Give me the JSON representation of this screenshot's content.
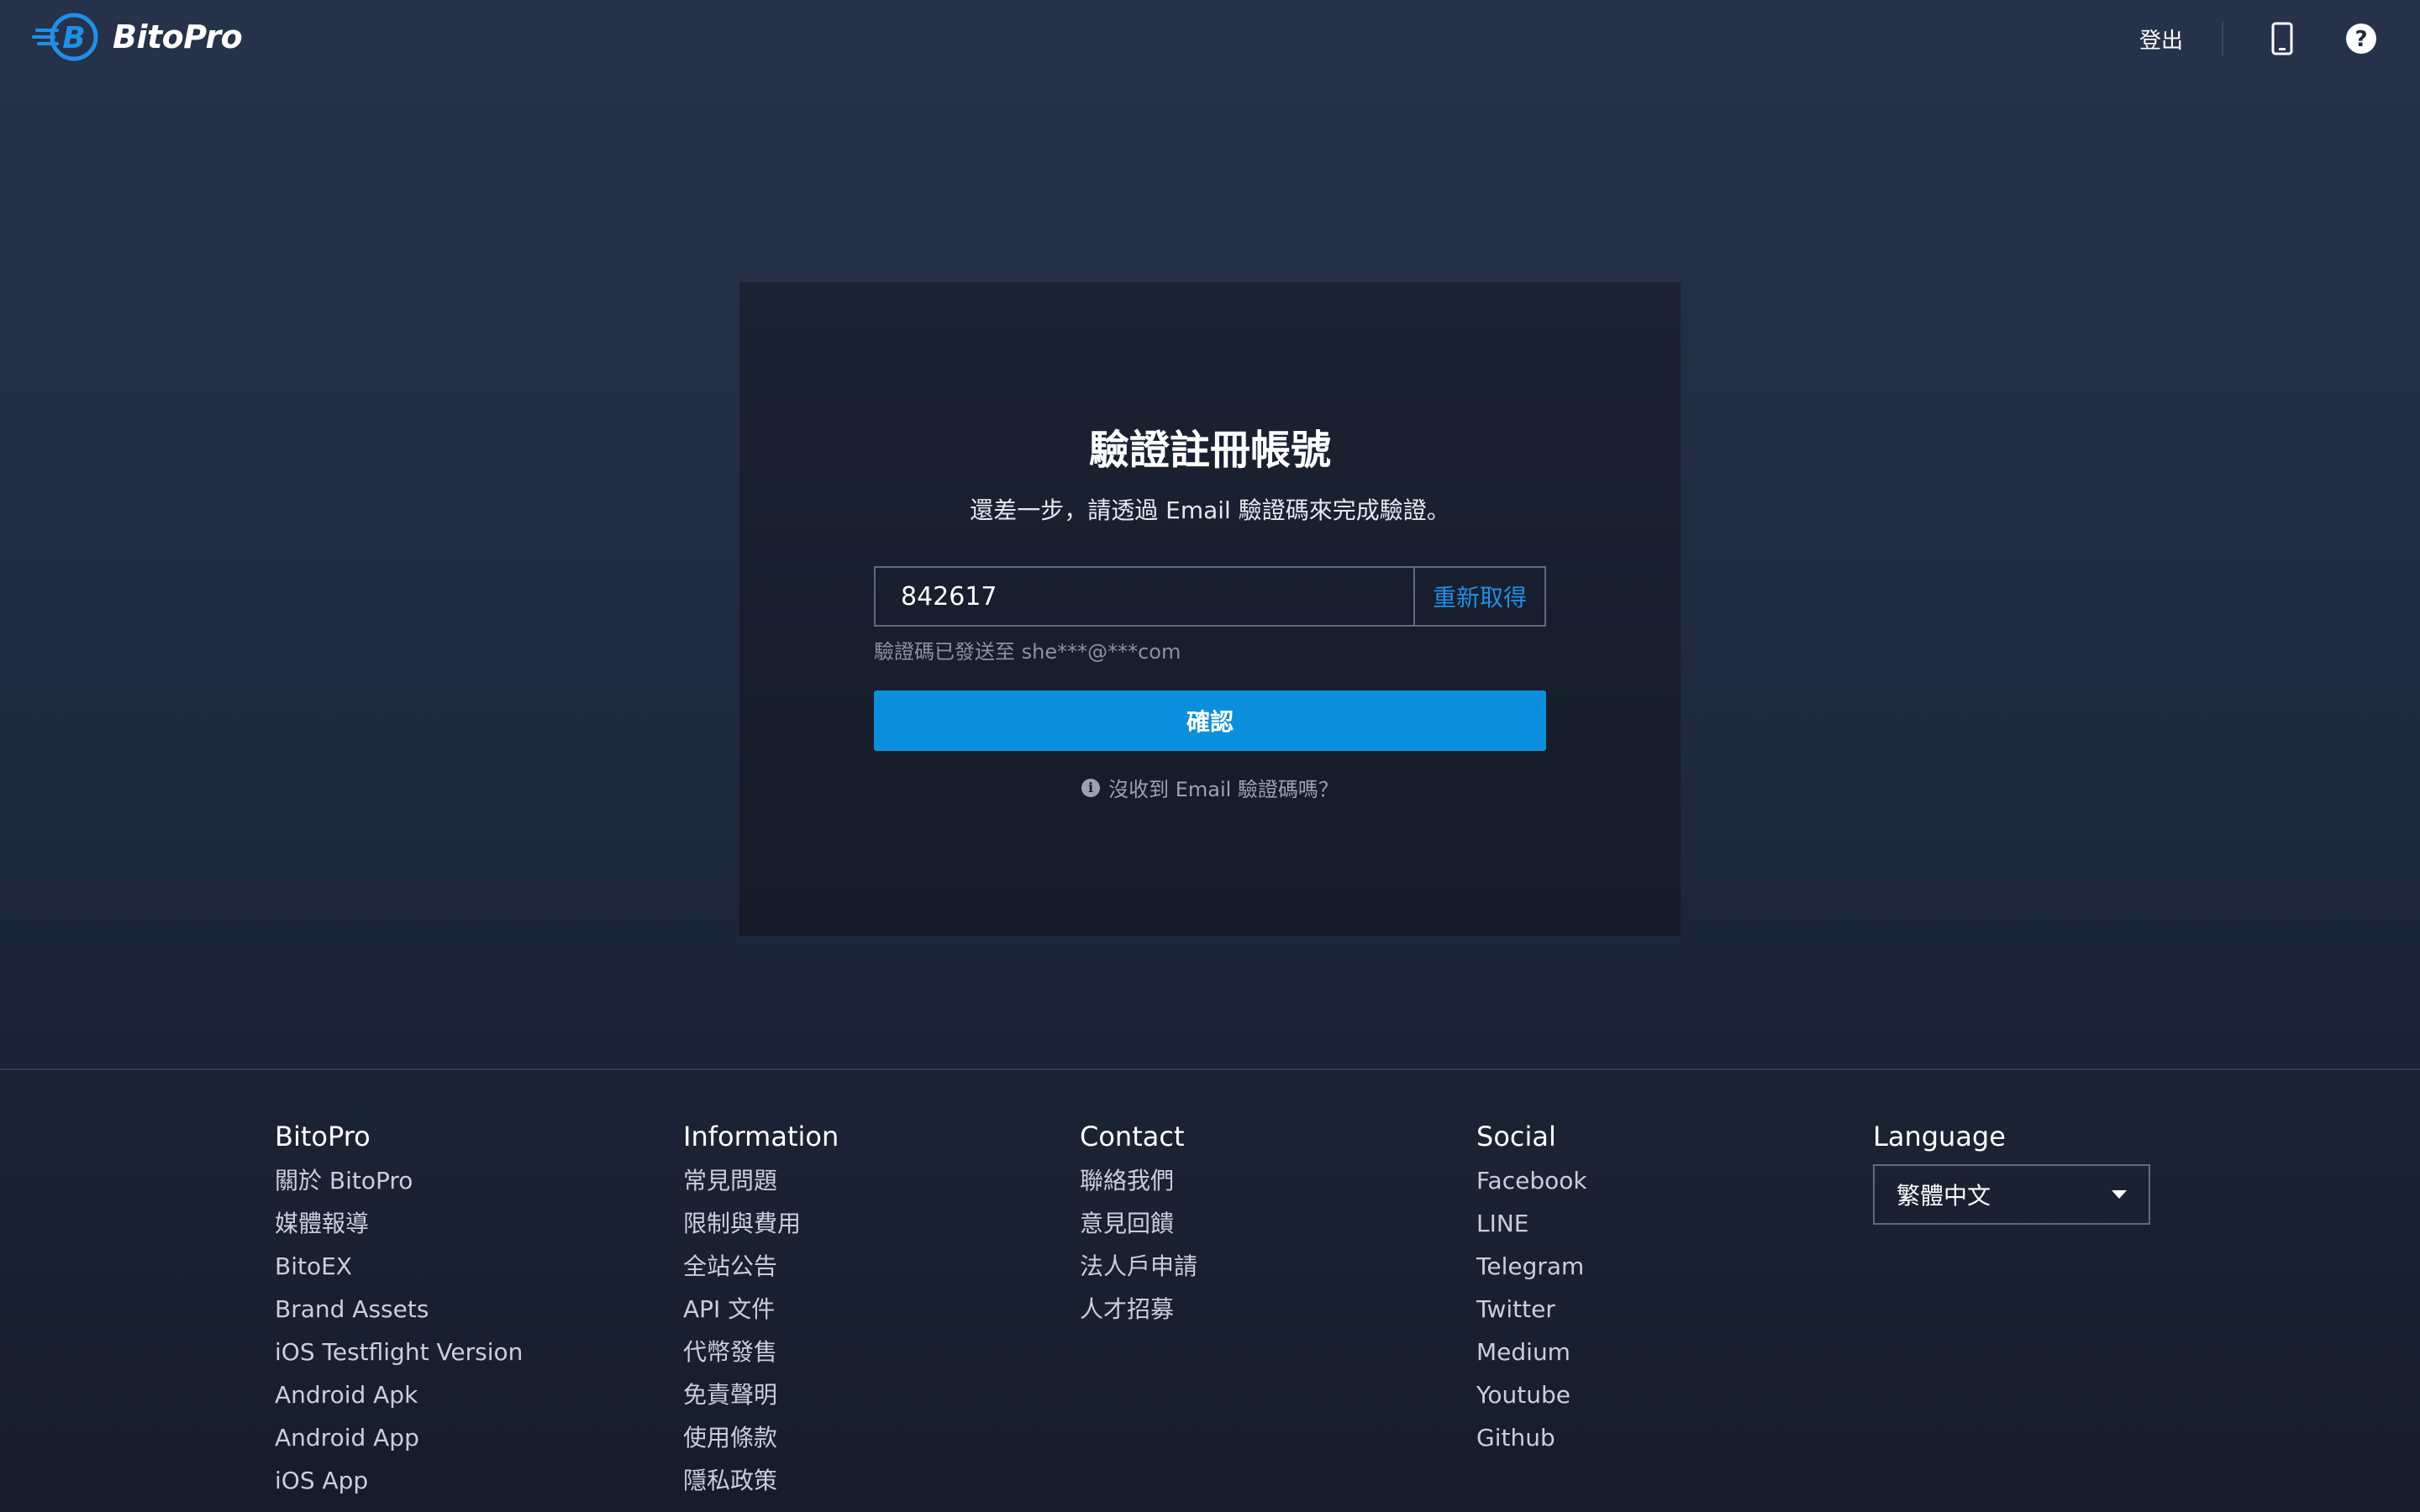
{
  "header": {
    "brand": "BitoPro",
    "logout": "登出",
    "icons": [
      "mobile-icon",
      "help-icon"
    ]
  },
  "verify": {
    "title": "驗證註冊帳號",
    "subtitle": "還差一步，請透過 Email 驗證碼來完成驗證。",
    "code_value": "842617",
    "resend_label": "重新取得",
    "hint": "驗證碼已發送至 she***@***com",
    "confirm_label": "確認",
    "no_email_label": "沒收到 Email 驗證碼嗎？"
  },
  "footer": {
    "bitopro": {
      "heading": "BitoPro",
      "links": [
        "關於 BitoPro",
        "媒體報導",
        "BitoEX",
        "Brand Assets",
        "iOS Testflight Version",
        "Android Apk",
        "Android App",
        "iOS App"
      ]
    },
    "information": {
      "heading": "Information",
      "links": [
        "常見問題",
        "限制與費用",
        "全站公告",
        "API 文件",
        "代幣發售",
        "免責聲明",
        "使用條款",
        "隱私政策"
      ]
    },
    "contact": {
      "heading": "Contact",
      "links": [
        "聯絡我們",
        "意見回饋",
        "法人戶申請",
        "人才招募"
      ]
    },
    "social": {
      "heading": "Social",
      "links": [
        "Facebook",
        "LINE",
        "Telegram",
        "Twitter",
        "Medium",
        "Youtube",
        "Github"
      ]
    },
    "language": {
      "heading": "Language",
      "selected": "繁體中文"
    }
  },
  "colors": {
    "accent": "#0b8fdc",
    "link_accent": "#1e90e8"
  }
}
